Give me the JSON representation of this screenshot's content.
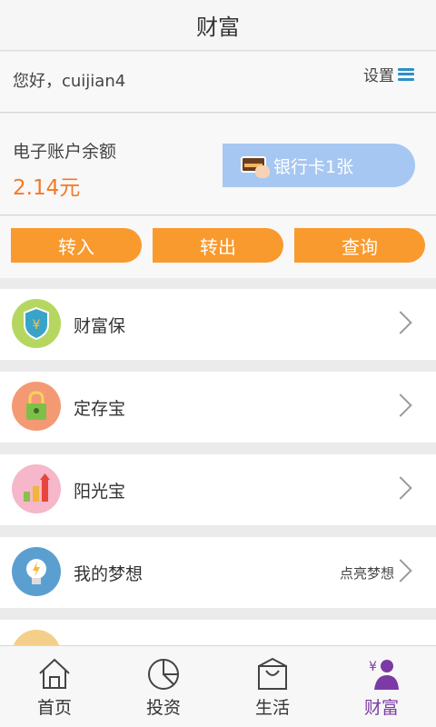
{
  "header": {
    "title": "财富"
  },
  "greeting": {
    "text": "您好，cuijian4",
    "settings_label": "设置"
  },
  "balance": {
    "label": "电子账户余额",
    "amount": "2.14元",
    "bankcard_label": "银行卡1张"
  },
  "actions": [
    {
      "label": "转入"
    },
    {
      "label": "转出"
    },
    {
      "label": "查询"
    }
  ],
  "products": [
    {
      "name": "财富保",
      "icon": "shield-yuan-icon"
    },
    {
      "name": "定存宝",
      "icon": "lock-icon"
    },
    {
      "name": "阳光宝",
      "icon": "rising-bars-icon"
    },
    {
      "name": "我的梦想",
      "icon": "lightbulb-icon",
      "right_text": "点亮梦想"
    },
    {
      "name": "",
      "icon": "partial-item-icon"
    }
  ],
  "tabs": [
    {
      "label": "首页",
      "icon": "home-icon"
    },
    {
      "label": "投资",
      "icon": "pie-chart-icon"
    },
    {
      "label": "生活",
      "icon": "shopping-bag-icon"
    },
    {
      "label": "财富",
      "icon": "user-yuan-icon",
      "active": true
    }
  ],
  "colors": {
    "accent": "#f99a2e",
    "amount": "#f07b2a",
    "active_tab": "#7c3aa4",
    "bankcard": "#a6c7f1"
  }
}
